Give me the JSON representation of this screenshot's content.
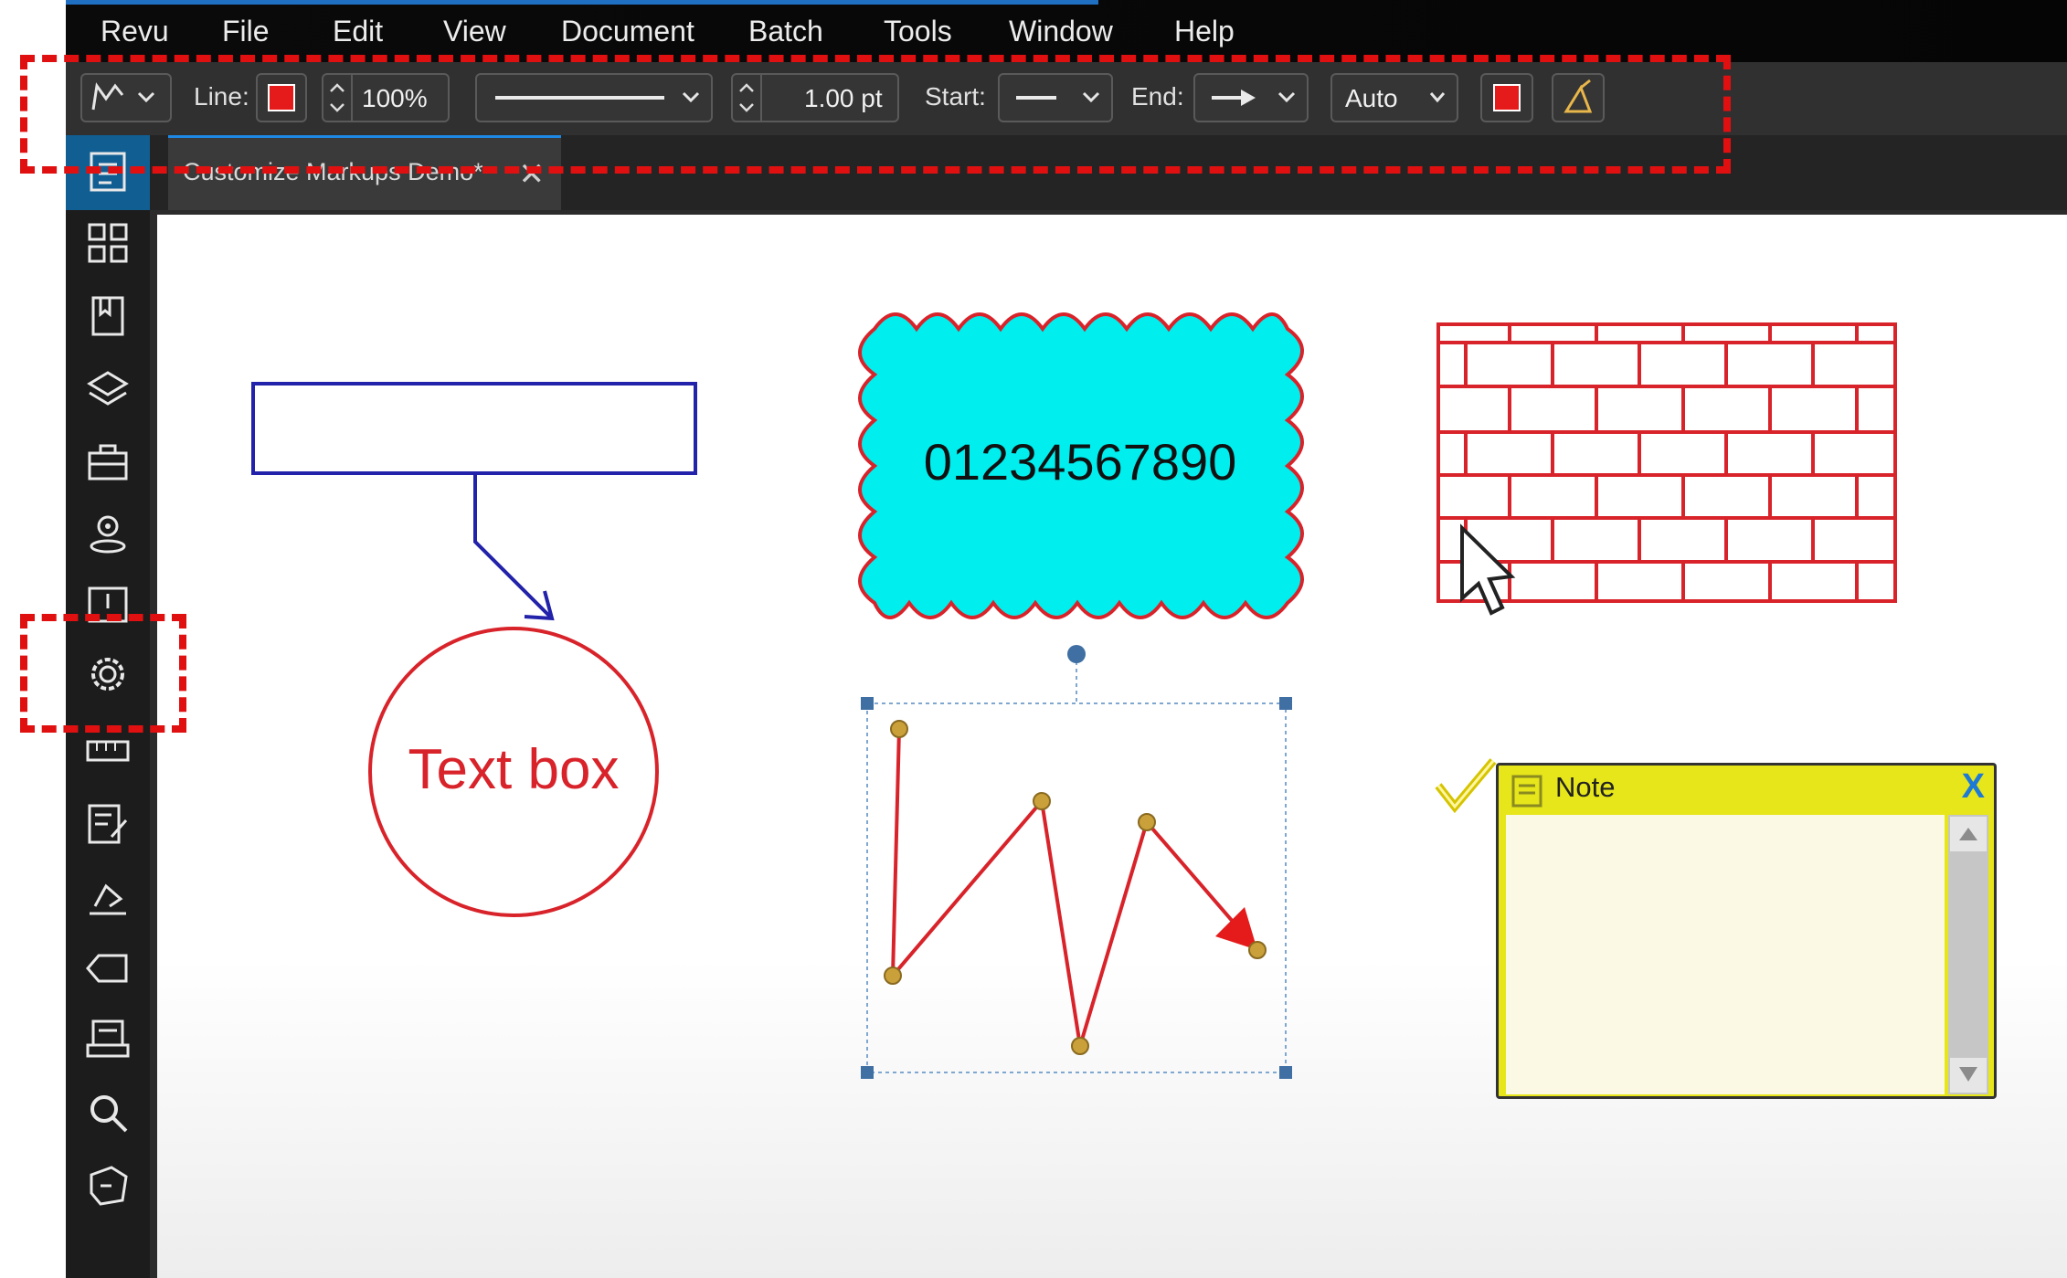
{
  "menu": {
    "items": [
      "Revu",
      "File",
      "Edit",
      "View",
      "Document",
      "Batch",
      "Tools",
      "Window",
      "Help"
    ]
  },
  "toolbar": {
    "line_label": "Line:",
    "opacity": "100%",
    "line_width": "1.00 pt",
    "start_label": "Start:",
    "end_label": "End:",
    "auto_value": "Auto",
    "line_color": "#e51b1b",
    "fill_color": "#e51b1b"
  },
  "tab": {
    "title": "Customize Markups Demo*",
    "close": "✕"
  },
  "canvas": {
    "cloud_text": "01234567890",
    "circle_text": "Text box",
    "note_title": "Note",
    "note_close": "X",
    "callout_color": "#2222aa",
    "cloud_fill": "#00eeee",
    "markup_red": "#d8232a"
  },
  "dock": {
    "icons": [
      "properties-icon",
      "thumbnails-icon",
      "bookmarks-icon",
      "layers-icon",
      "toolchest-icon",
      "places-icon",
      "markups-list-icon",
      "settings-icon",
      "measure-icon",
      "forms-icon",
      "signatures-icon",
      "tags-icon",
      "file-access-icon",
      "search-icon",
      "studio-icon"
    ]
  },
  "colors": {
    "annotation_red": "#e01010",
    "menubar_bg": "#050505",
    "accent_blue": "#1e88e5"
  }
}
